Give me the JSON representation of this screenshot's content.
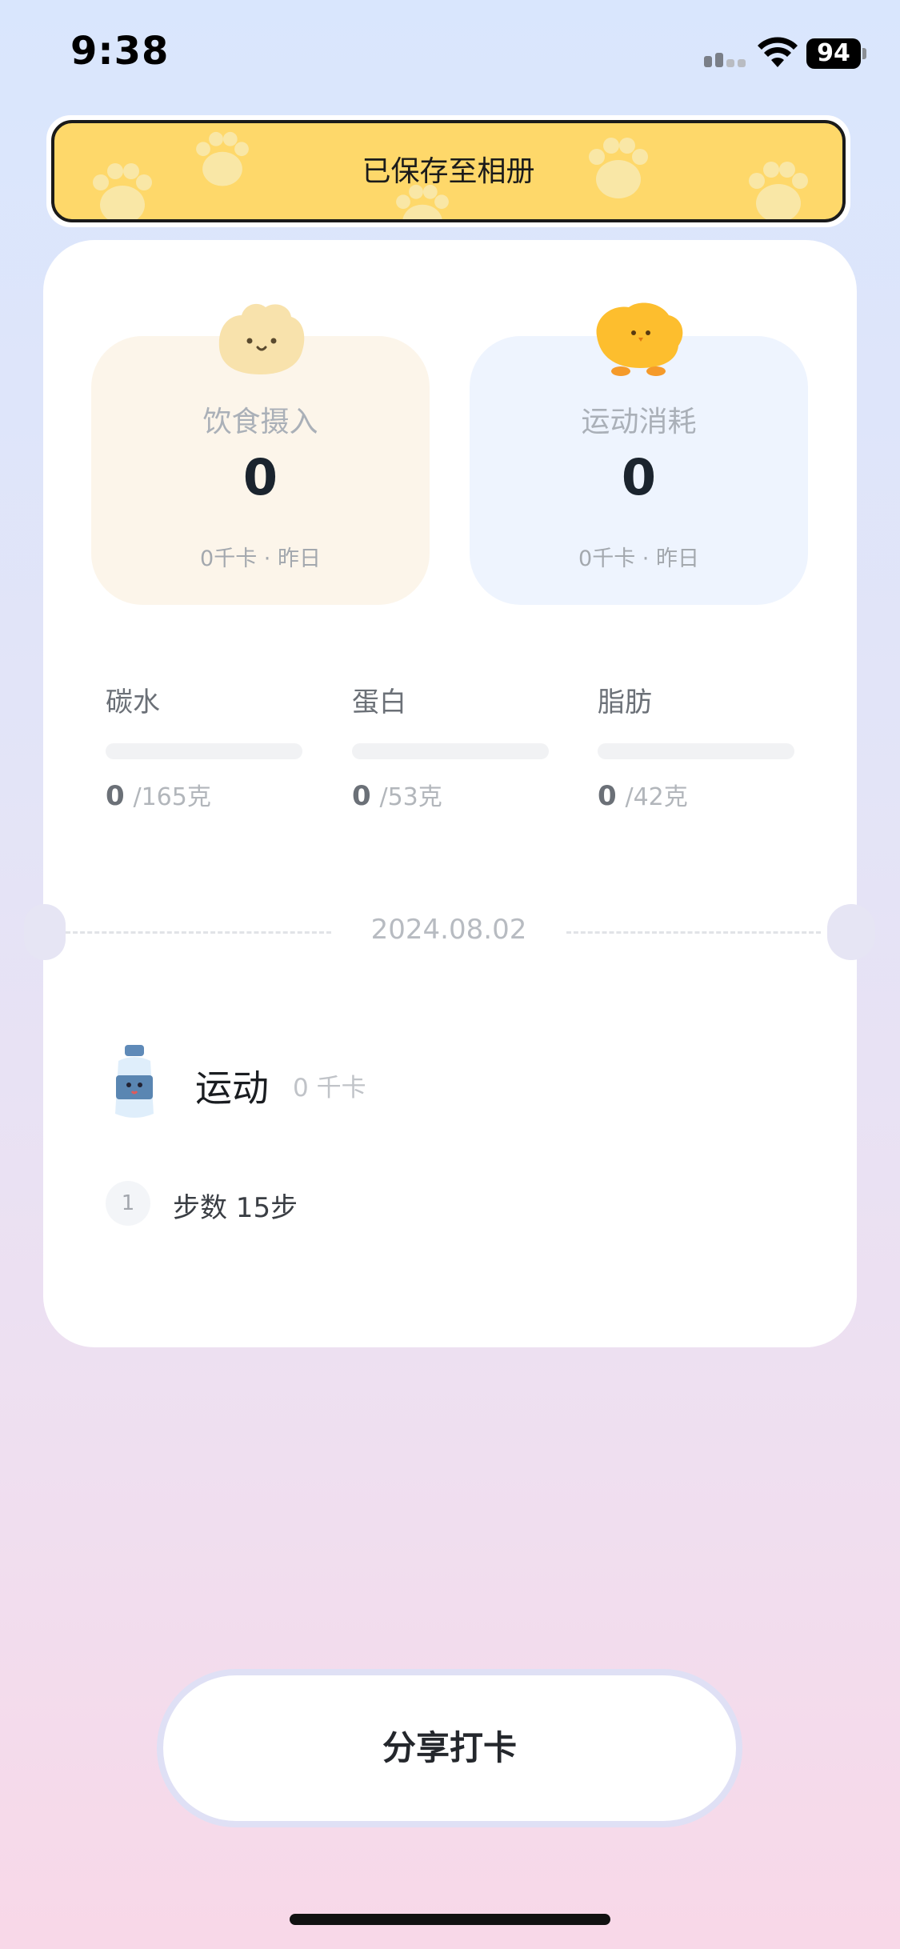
{
  "status_bar": {
    "time": "9:38",
    "battery": "94"
  },
  "toast": {
    "text": "已保存至相册"
  },
  "summary": {
    "food": {
      "label": "饮食摄入",
      "value": "0",
      "sub": "0千卡 · 昨日"
    },
    "exercise": {
      "label": "运动消耗",
      "value": "0",
      "sub": "0千卡 · 昨日"
    }
  },
  "macros": [
    {
      "label": "碳水",
      "current": "0",
      "total": "/165克",
      "progress": 0
    },
    {
      "label": "蛋白",
      "current": "0",
      "total": "/53克",
      "progress": 0
    },
    {
      "label": "脂肪",
      "current": "0",
      "total": "/42克",
      "progress": 0
    }
  ],
  "date": "2024.08.02",
  "exercise_section": {
    "title": "运动",
    "kcal": "0 千卡",
    "items": [
      {
        "index": "1",
        "text": "步数 15步"
      }
    ]
  },
  "share_button": {
    "label": "分享打卡"
  },
  "colors": {
    "toast_yellow": "#fed86a",
    "food_bg": "#fcf5ea",
    "exercise_bg": "#eef4fe"
  }
}
